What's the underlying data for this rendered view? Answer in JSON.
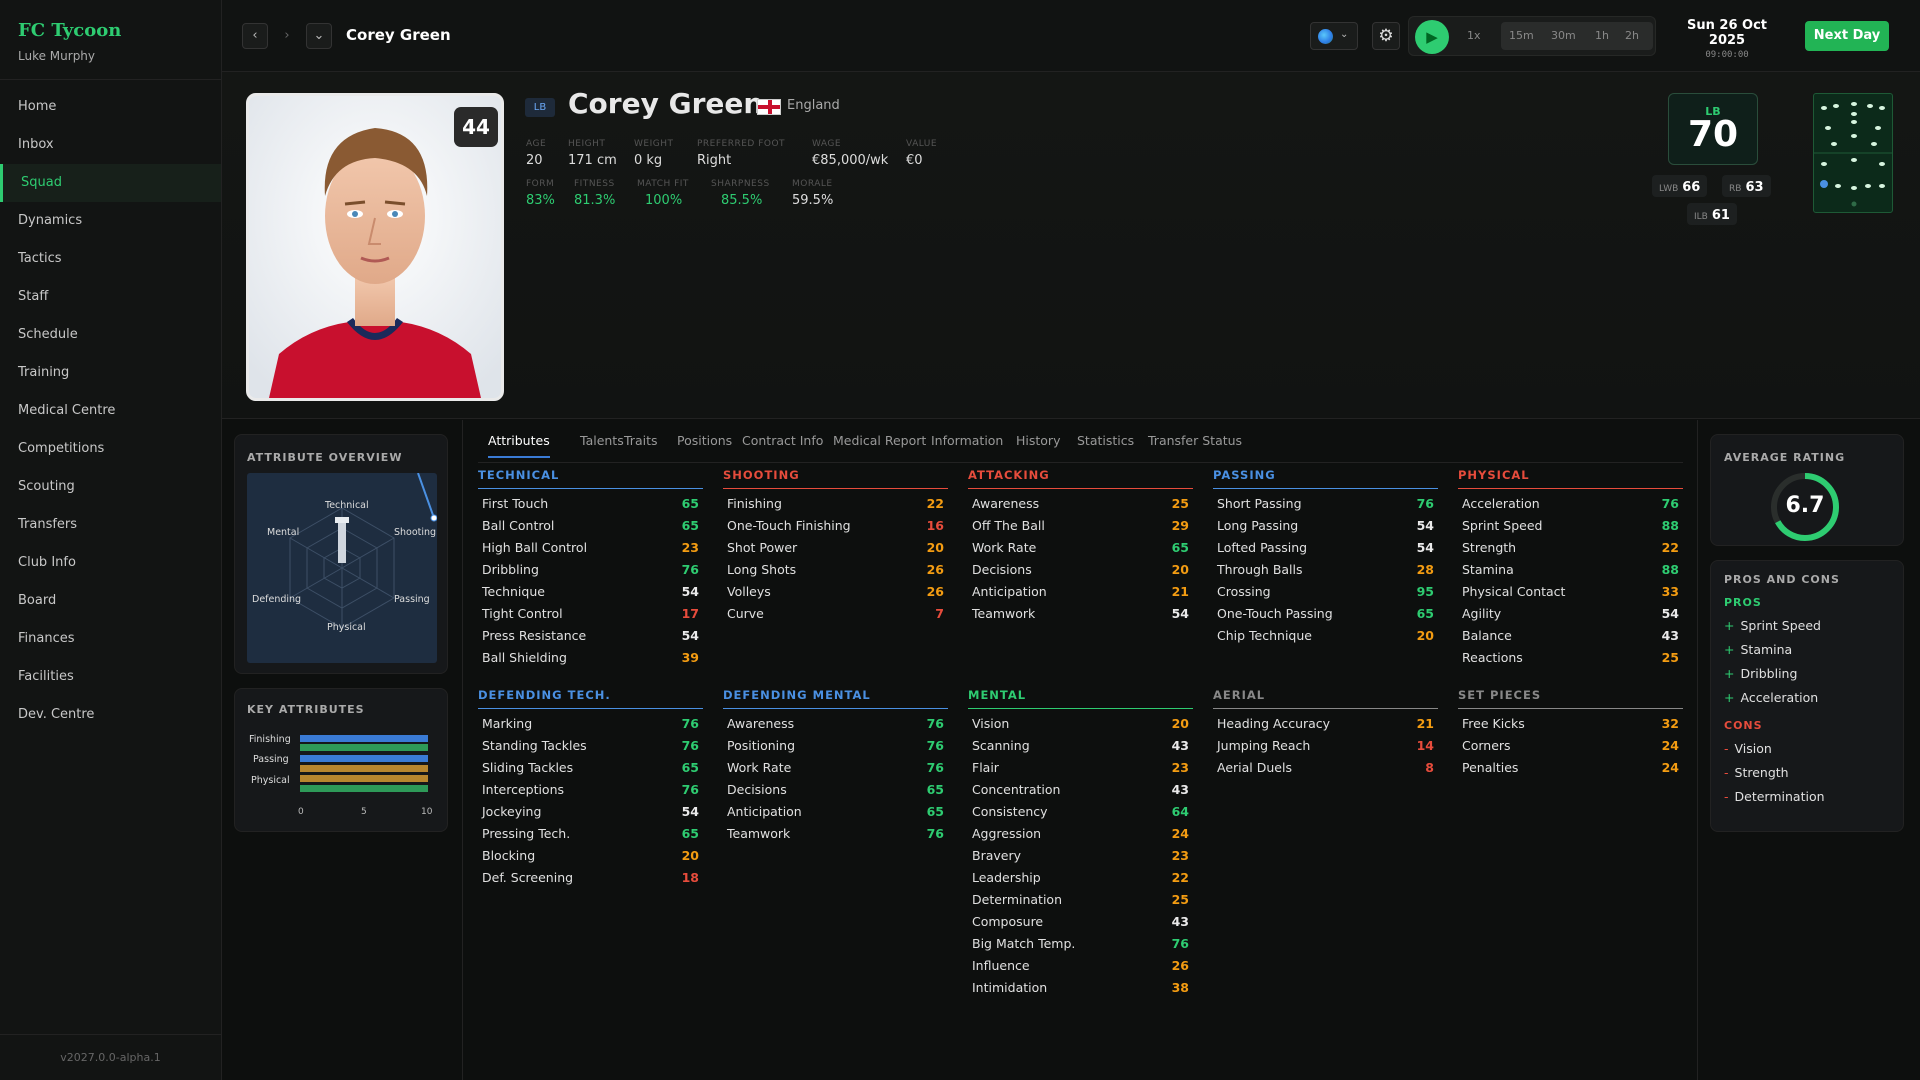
{
  "app": {
    "title": "FC Tycoon",
    "user": "Luke Murphy",
    "version": "v2027.0.0-alpha.1"
  },
  "nav": [
    "Home",
    "Inbox",
    "Squad",
    "Dynamics",
    "Tactics",
    "Staff",
    "Schedule",
    "Training",
    "Medical Centre",
    "Competitions",
    "Scouting",
    "Transfers",
    "Club Info",
    "Board",
    "Finances",
    "Facilities",
    "Dev. Centre"
  ],
  "nav_active": "Squad",
  "topbar": {
    "title": "Corey Green",
    "speed_label": "1x",
    "speeds": [
      "15m",
      "30m",
      "1h",
      "2h"
    ],
    "date": "Sun 26 Oct 2025",
    "time": "09:00:00",
    "next_day": "Next Day"
  },
  "player": {
    "number": "44",
    "position": "LB",
    "name": "Corey Green",
    "country": "England",
    "stats": [
      {
        "label": "AGE",
        "value": "20"
      },
      {
        "label": "HEIGHT",
        "value": "171 cm"
      },
      {
        "label": "WEIGHT",
        "value": "0 kg"
      },
      {
        "label": "PREFERRED FOOT",
        "value": "Right"
      },
      {
        "label": "WAGE",
        "value": "€85,000/wk"
      },
      {
        "label": "VALUE",
        "value": "€0"
      }
    ],
    "condition": [
      {
        "label": "FORM",
        "value": "83%"
      },
      {
        "label": "FITNESS",
        "value": "81.3%"
      },
      {
        "label": "MATCH FIT",
        "value": "100%"
      },
      {
        "label": "SHARPNESS",
        "value": "85.5%"
      },
      {
        "label": "MORALE",
        "value": "59.5%"
      }
    ],
    "overall": {
      "position": "LB",
      "value": "70"
    },
    "alt_positions": [
      {
        "position": "LWB",
        "value": "66"
      },
      {
        "position": "RB",
        "value": "63"
      },
      {
        "position": "ILB",
        "value": "61"
      }
    ]
  },
  "tabs": [
    "Attributes",
    "Talents",
    "Traits",
    "Positions",
    "Contract Info",
    "Medical Report",
    "Information",
    "History",
    "Statistics",
    "Transfer Status"
  ],
  "active_tab": "Attributes",
  "overview": {
    "title": "ATTRIBUTE OVERVIEW",
    "axes": [
      "Technical",
      "Shooting",
      "Passing",
      "Physical",
      "Defending",
      "Mental"
    ]
  },
  "key_attributes": {
    "title": "KEY ATTRIBUTES",
    "labels": [
      "Finishing",
      "Passing",
      "Physical"
    ],
    "ticks": [
      "0",
      "5",
      "10"
    ]
  },
  "groups": [
    {
      "title": "TECHNICAL",
      "color": "#4a90e2",
      "items": [
        [
          "First Touch",
          "65"
        ],
        [
          "Ball Control",
          "65"
        ],
        [
          "High Ball Control",
          "23"
        ],
        [
          "Dribbling",
          "76"
        ],
        [
          "Technique",
          "54"
        ],
        [
          "Tight Control",
          "17"
        ],
        [
          "Press Resistance",
          "54"
        ],
        [
          "Ball Shielding",
          "39"
        ]
      ]
    },
    {
      "title": "SHOOTING",
      "color": "#e74c3c",
      "items": [
        [
          "Finishing",
          "22"
        ],
        [
          "One-Touch Finishing",
          "16"
        ],
        [
          "Shot Power",
          "20"
        ],
        [
          "Long Shots",
          "26"
        ],
        [
          "Volleys",
          "26"
        ],
        [
          "Curve",
          "7"
        ]
      ]
    },
    {
      "title": "ATTACKING",
      "color": "#e74c3c",
      "items": [
        [
          "Awareness",
          "25"
        ],
        [
          "Off The Ball",
          "29"
        ],
        [
          "Work Rate",
          "65"
        ],
        [
          "Decisions",
          "20"
        ],
        [
          "Anticipation",
          "21"
        ],
        [
          "Teamwork",
          "54"
        ]
      ]
    },
    {
      "title": "PASSING",
      "color": "#4a90e2",
      "items": [
        [
          "Short Passing",
          "76"
        ],
        [
          "Long Passing",
          "54"
        ],
        [
          "Lofted Passing",
          "54"
        ],
        [
          "Through Balls",
          "28"
        ],
        [
          "Crossing",
          "95"
        ],
        [
          "One-Touch Passing",
          "65"
        ],
        [
          "Chip Technique",
          "20"
        ]
      ]
    },
    {
      "title": "PHYSICAL",
      "color": "#e74c3c",
      "items": [
        [
          "Acceleration",
          "76"
        ],
        [
          "Sprint Speed",
          "88"
        ],
        [
          "Strength",
          "22"
        ],
        [
          "Stamina",
          "88"
        ],
        [
          "Physical Contact",
          "33"
        ],
        [
          "Agility",
          "54"
        ],
        [
          "Balance",
          "43"
        ],
        [
          "Reactions",
          "25"
        ]
      ]
    },
    {
      "title": "DEFENDING TECH.",
      "color": "#4a90e2",
      "items": [
        [
          "Marking",
          "76"
        ],
        [
          "Standing Tackles",
          "76"
        ],
        [
          "Sliding Tackles",
          "65"
        ],
        [
          "Interceptions",
          "76"
        ],
        [
          "Jockeying",
          "54"
        ],
        [
          "Pressing Tech.",
          "65"
        ],
        [
          "Blocking",
          "20"
        ],
        [
          "Def. Screening",
          "18"
        ]
      ]
    },
    {
      "title": "DEFENDING MENTAL",
      "color": "#4a90e2",
      "items": [
        [
          "Awareness",
          "76"
        ],
        [
          "Positioning",
          "76"
        ],
        [
          "Work Rate",
          "76"
        ],
        [
          "Decisions",
          "65"
        ],
        [
          "Anticipation",
          "65"
        ],
        [
          "Teamwork",
          "76"
        ]
      ]
    },
    {
      "title": "MENTAL",
      "color": "#2ecc71",
      "items": [
        [
          "Vision",
          "20"
        ],
        [
          "Scanning",
          "43"
        ],
        [
          "Flair",
          "23"
        ],
        [
          "Concentration",
          "43"
        ],
        [
          "Consistency",
          "64"
        ],
        [
          "Aggression",
          "24"
        ],
        [
          "Bravery",
          "23"
        ],
        [
          "Leadership",
          "22"
        ],
        [
          "Determination",
          "25"
        ],
        [
          "Composure",
          "43"
        ],
        [
          "Big Match Temp.",
          "76"
        ],
        [
          "Influence",
          "26"
        ],
        [
          "Intimidation",
          "38"
        ]
      ]
    },
    {
      "title": "AERIAL",
      "color": "#888888",
      "items": [
        [
          "Heading Accuracy",
          "21"
        ],
        [
          "Jumping Reach",
          "14"
        ],
        [
          "Aerial Duels",
          "8"
        ]
      ]
    },
    {
      "title": "SET PIECES",
      "color": "#888888",
      "items": [
        [
          "Free Kicks",
          "32"
        ],
        [
          "Corners",
          "24"
        ],
        [
          "Penalties",
          "24"
        ]
      ]
    }
  ],
  "rating": {
    "title": "AVERAGE RATING",
    "value": "6.7",
    "fraction": 0.67
  },
  "pros_cons": {
    "title": "PROS AND CONS",
    "pros_label": "PROS",
    "cons_label": "CONS",
    "pros": [
      "Sprint Speed",
      "Stamina",
      "Dribbling",
      "Acceleration"
    ],
    "cons": [
      "Vision",
      "Strength",
      "Determination"
    ]
  },
  "colors": {
    "accent": "#2ecc71",
    "pro": "#2ecc71",
    "con": "#e74c3c",
    "high": "#2ecc71",
    "mid": "#f39c12",
    "low": "#e74c3c"
  }
}
